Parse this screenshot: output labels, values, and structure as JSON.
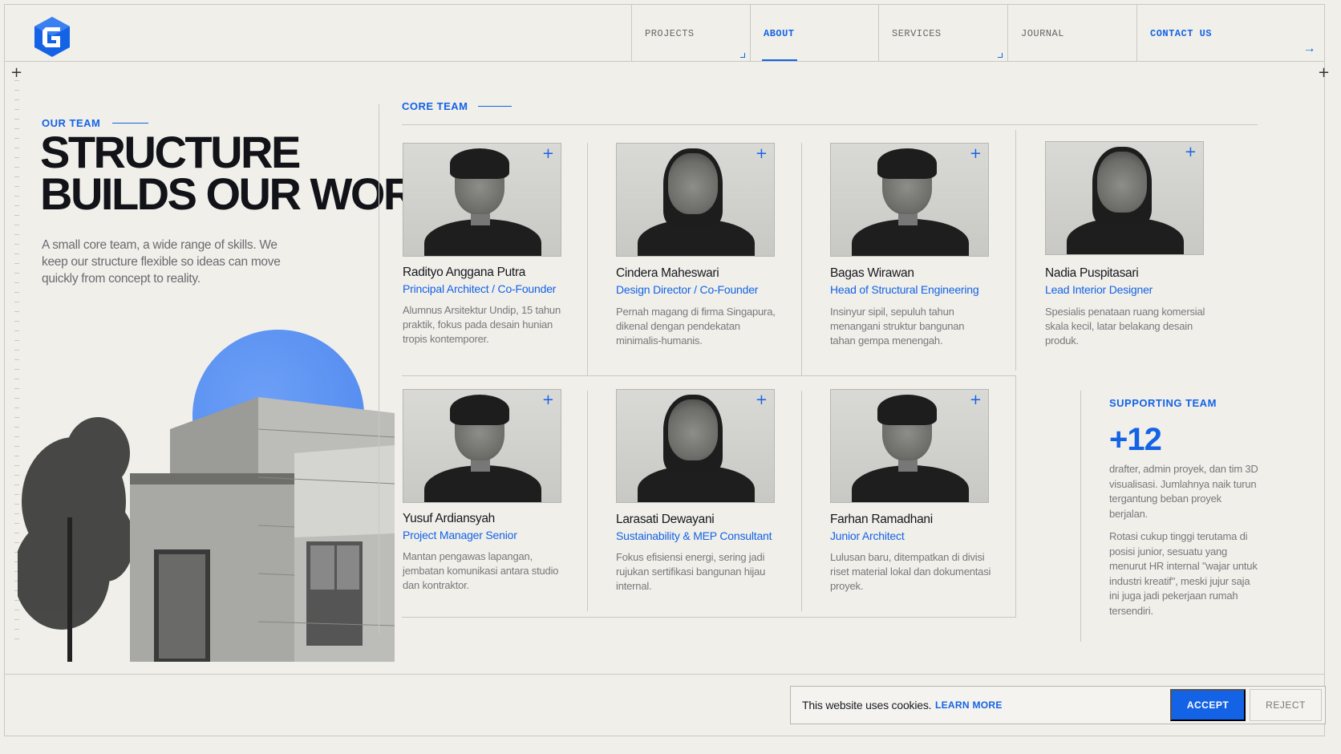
{
  "nav": {
    "items": [
      {
        "label": "PROJECTS"
      },
      {
        "label": "ABOUT"
      },
      {
        "label": "SERVICES"
      },
      {
        "label": "JOURNAL"
      },
      {
        "label": "CONTACT US"
      }
    ],
    "active": "ABOUT"
  },
  "hero": {
    "eyebrow": "OUR TEAM",
    "title_line1": "STRUCTURE",
    "title_line2": "BUILDS OUR WORK",
    "intro": "A small core team, a wide range of skills. We keep our structure flexible so ideas can move quickly from concept to reality."
  },
  "core_team": {
    "label": "CORE TEAM",
    "members": [
      {
        "name": "Radityo Anggana Putra",
        "role": "Principal Architect / Co-Founder",
        "bio": "Alumnus Arsitektur Undip, 15 tahun praktik, fokus pada desain hunian tropis kontemporer."
      },
      {
        "name": "Cindera Maheswari",
        "role": "Design Director / Co-Founder",
        "bio": "Pernah magang di firma Singapura, dikenal dengan pendekatan minimalis-humanis."
      },
      {
        "name": "Bagas Wirawan",
        "role": "Head of Structural Engineering",
        "bio": "Insinyur sipil, sepuluh tahun menangani struktur bangunan tahan gempa menengah."
      },
      {
        "name": "Nadia Puspitasari",
        "role": "Lead Interior Designer",
        "bio": "Spesialis penataan ruang komersial skala kecil, latar belakang desain produk."
      },
      {
        "name": "Yusuf Ardiansyah",
        "role": "Project Manager Senior",
        "bio": "Mantan pengawas lapangan, jembatan komunikasi antara studio dan kontraktor."
      },
      {
        "name": "Larasati Dewayani",
        "role": "Sustainability & MEP Consultant",
        "bio": "Fokus efisiensi energi, sering jadi rujukan sertifikasi bangunan hijau internal."
      },
      {
        "name": "Farhan Ramadhani",
        "role": "Junior Architect",
        "bio": "Lulusan baru, ditempatkan di divisi riset material lokal dan dokumentasi proyek."
      }
    ]
  },
  "supporting_team": {
    "label": "SUPPORTING TEAM",
    "count": "+12",
    "text1": "drafter, admin proyek, dan tim 3D visualisasi. Jumlahnya naik turun tergantung beban proyek berjalan.",
    "text2": "Rotasi cukup tinggi terutama di posisi junior, sesuatu yang menurut HR internal \"wajar untuk industri kreatif\", meski jujur saja ini juga jadi pekerjaan rumah tersendiri."
  },
  "cookie": {
    "text": "This website uses cookies.",
    "link": "LEARN MORE",
    "accept": "ACCEPT",
    "reject": "REJECT"
  },
  "colors": {
    "accent": "#1463e6",
    "background": "#f0efea",
    "sun": "#5b8ff0"
  }
}
